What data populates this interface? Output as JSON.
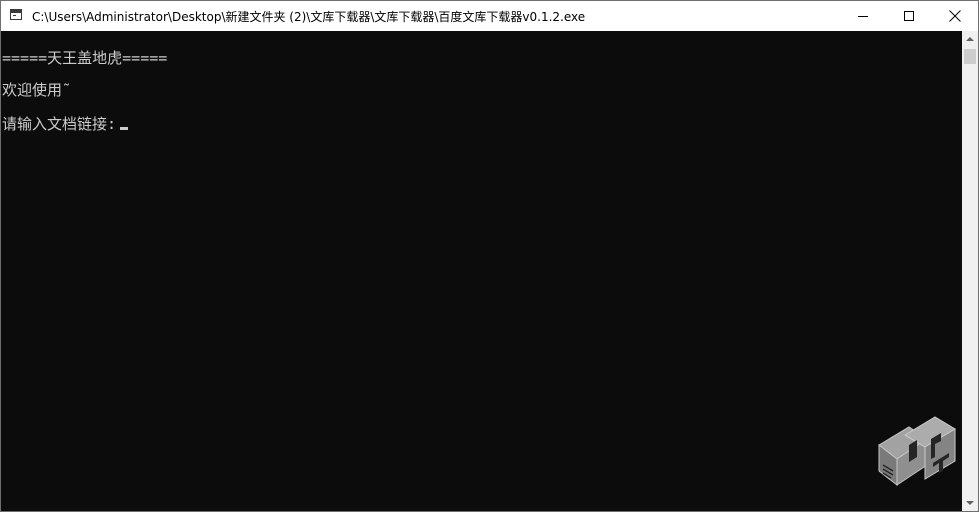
{
  "window": {
    "title": "C:\\Users\\Administrator\\Desktop\\新建文件夹 (2)\\文库下载器\\文库下载器\\百度文库下载器v0.1.2.exe",
    "icon": "console-app-icon",
    "controls": [
      "minimize-icon",
      "maximize-icon",
      "close-icon"
    ]
  },
  "console": {
    "lines": [
      "=====天王盖地虎=====",
      "欢迎使用˜",
      "请输入文档链接:"
    ],
    "background": "#0c0c0c",
    "foreground": "#cccccc"
  },
  "watermark": {
    "logo": "pxtech-logo"
  }
}
